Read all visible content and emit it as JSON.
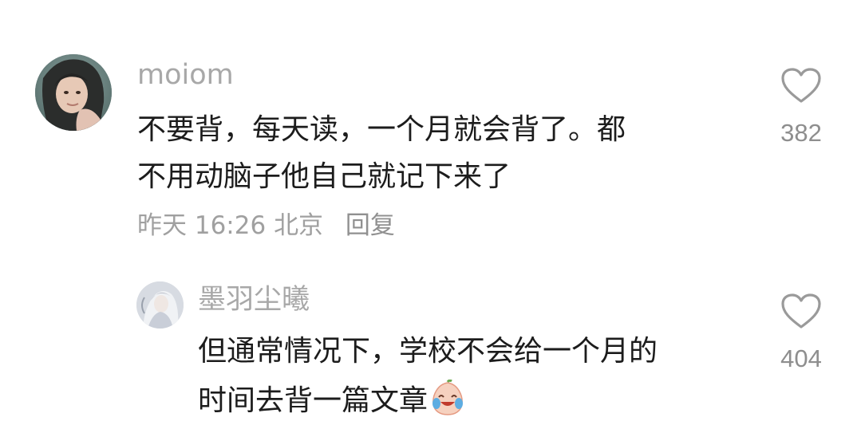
{
  "comment": {
    "username": "moiom",
    "lines": [
      "不要背，每天读，一个月就会背了。都",
      "不用动脑子他自己就记下来了"
    ],
    "date": "昨天",
    "time": "16:26",
    "location": "北京",
    "reply_label": "回复",
    "like_count": "382",
    "avatar_icon": "profile-photo"
  },
  "reply": {
    "username": "墨羽尘曦",
    "lines": [
      "但通常情况下，学校不会给一个月的",
      "时间去背一篇文章"
    ],
    "emoji": "crying-laughing-emoji",
    "like_count": "404",
    "avatar_icon": "profile-photo"
  },
  "colors": {
    "text": "#1c1c1c",
    "muted": "#a8a8a8",
    "heart_stroke": "#9a9a9a"
  }
}
